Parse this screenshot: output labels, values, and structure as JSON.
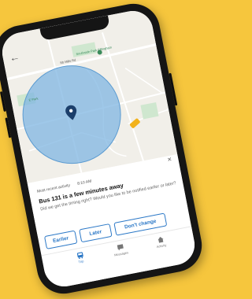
{
  "map": {
    "labels": {
      "street": "Sb Mills Rd",
      "park": "Southside Park Effingham",
      "park_left": "E Park"
    },
    "colors": {
      "radius_fill": "#7fb6e2",
      "pin": "#1c3f6b",
      "bus_marker": "#f2b21b"
    }
  },
  "notification": {
    "recent_label": "Most recent activity",
    "time": "8:10 AM",
    "title": "Bus 131 is a few minutes away",
    "question": "Did we get the timing right? Would you like to be notified earlier or later?"
  },
  "actions": {
    "earlier": "Earlier",
    "later": "Later",
    "dont_change": "Don't change"
  },
  "tabs": [
    {
      "label": "Trip",
      "icon": "bus-icon"
    },
    {
      "label": "Messages",
      "icon": "message-icon"
    },
    {
      "label": "Activity",
      "icon": "home-icon"
    }
  ],
  "accent_color": "#2b78c7",
  "background_color": "#f6c63d"
}
